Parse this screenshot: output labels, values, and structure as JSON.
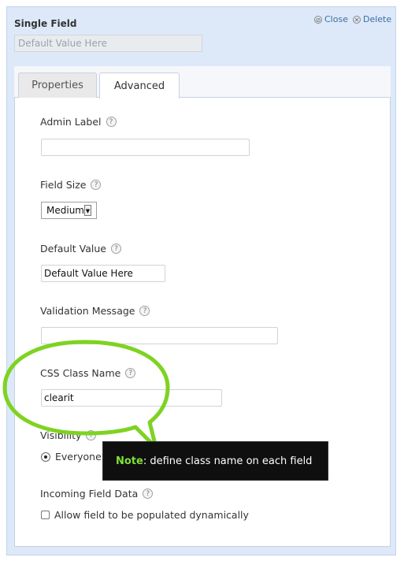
{
  "header": {
    "title": "Single Field",
    "default_preview": "Default Value Here",
    "close_label": "Close",
    "delete_label": "Delete"
  },
  "tabs": [
    {
      "label": "Properties",
      "active": false
    },
    {
      "label": "Advanced",
      "active": true
    }
  ],
  "fields": {
    "admin_label": {
      "label": "Admin Label",
      "value": ""
    },
    "field_size": {
      "label": "Field Size",
      "selected": "Medium"
    },
    "default_value": {
      "label": "Default Value",
      "value": "Default Value Here"
    },
    "validation_message": {
      "label": "Validation Message",
      "value": ""
    },
    "css_class_name": {
      "label": "CSS Class Name",
      "value": "clearit"
    },
    "visibility": {
      "label": "Visibility",
      "option_label": "Everyone"
    },
    "incoming_field_data": {
      "label": "Incoming Field Data",
      "checkbox_label": "Allow field to be populated dynamically",
      "checked": false
    }
  },
  "tooltip": {
    "note_label": "Note",
    "text": ": define class name on each field"
  },
  "colors": {
    "panel_bg": "#dde9f8",
    "highlight_green": "#7ed321",
    "link_blue": "#3a6ea5"
  },
  "icons": {
    "help": "question-mark-icon",
    "close": "close-circle-icon",
    "delete": "delete-x-icon"
  }
}
